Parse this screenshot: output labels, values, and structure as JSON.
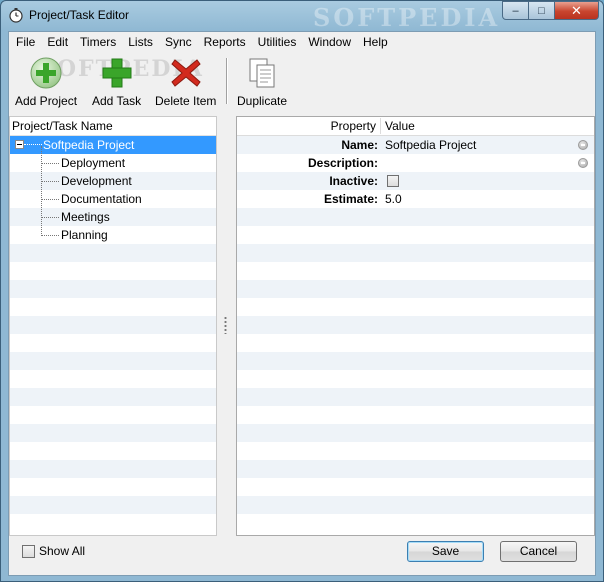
{
  "window": {
    "title": "Project/Task Editor",
    "watermark": "SOFTPEDIA",
    "controls": {
      "minimize": "–",
      "maximize": "□",
      "close": "✕"
    }
  },
  "menu": [
    "File",
    "Edit",
    "Timers",
    "Lists",
    "Sync",
    "Reports",
    "Utilities",
    "Window",
    "Help"
  ],
  "toolbar": {
    "add_project": {
      "label": "Add Project",
      "icon": "add-project-icon"
    },
    "add_task": {
      "label": "Add Task",
      "icon": "add-task-icon"
    },
    "delete_item": {
      "label": "Delete Item",
      "icon": "delete-icon"
    },
    "duplicate": {
      "label": "Duplicate",
      "icon": "duplicate-icon"
    },
    "watermark": "SOFTPEDIA"
  },
  "tree": {
    "header": "Project/Task Name",
    "root": "Softpedia Project",
    "children": [
      "Deployment",
      "Development",
      "Documentation",
      "Meetings",
      "Planning"
    ]
  },
  "properties": {
    "headers": {
      "property": "Property",
      "value": "Value"
    },
    "rows": [
      {
        "key": "Name:",
        "value": "Softpedia Project"
      },
      {
        "key": "Description:",
        "value": ""
      },
      {
        "key": "Inactive:",
        "value": ""
      },
      {
        "key": "Estimate:",
        "value": "5.0"
      }
    ]
  },
  "footer": {
    "show_all": "Show All",
    "save": "Save",
    "cancel": "Cancel"
  },
  "colors": {
    "selection": "#3399ff",
    "alt_row": "#eef3f8",
    "delete_red": "#d22a1e",
    "add_green": "#3aa52a"
  }
}
